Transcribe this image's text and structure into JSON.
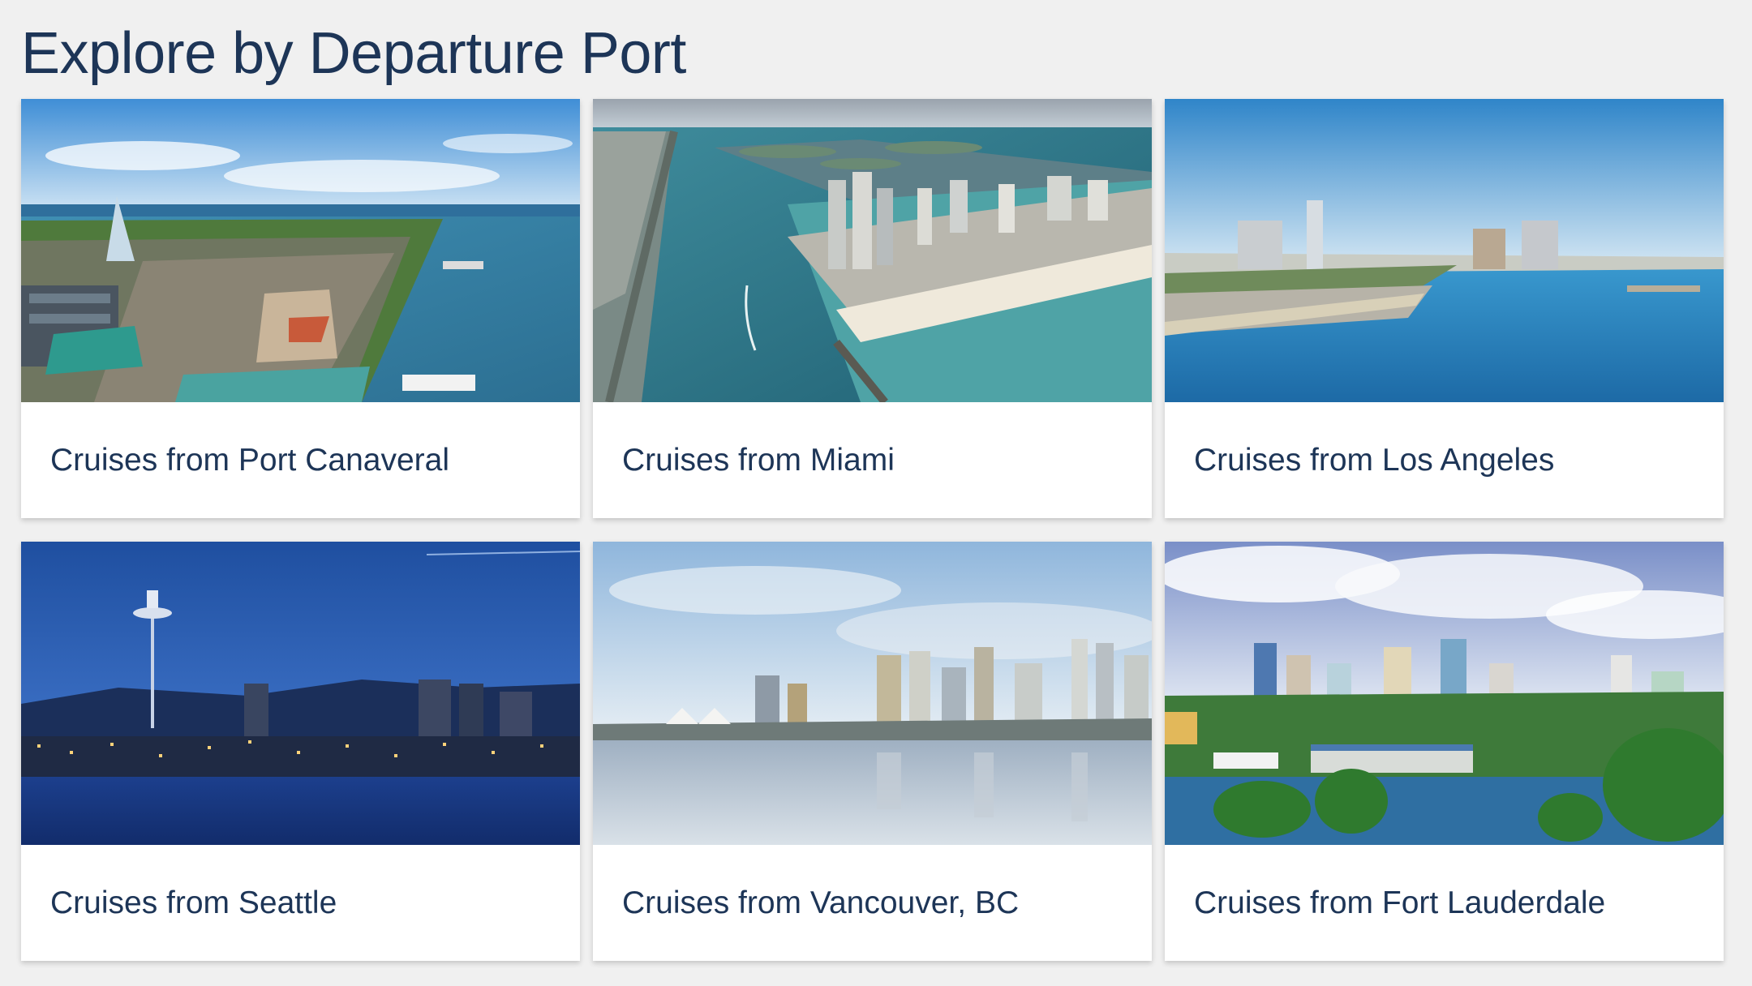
{
  "section": {
    "title": "Explore by Departure Port"
  },
  "ports": [
    {
      "label": "Cruises from Port Canaveral",
      "image": "port-canaveral-aerial-photo"
    },
    {
      "label": "Cruises from Miami",
      "image": "miami-inlet-aerial-photo"
    },
    {
      "label": "Cruises from Los Angeles",
      "image": "los-angeles-harbor-photo"
    },
    {
      "label": "Cruises from Seattle",
      "image": "seattle-skyline-night-photo"
    },
    {
      "label": "Cruises from Vancouver, BC",
      "image": "vancouver-waterfront-photo"
    },
    {
      "label": "Cruises from Fort Lauderdale",
      "image": "fort-lauderdale-marina-photo"
    }
  ],
  "colors": {
    "background": "#f0f0f0",
    "card": "#ffffff",
    "text": "#1d3557"
  }
}
